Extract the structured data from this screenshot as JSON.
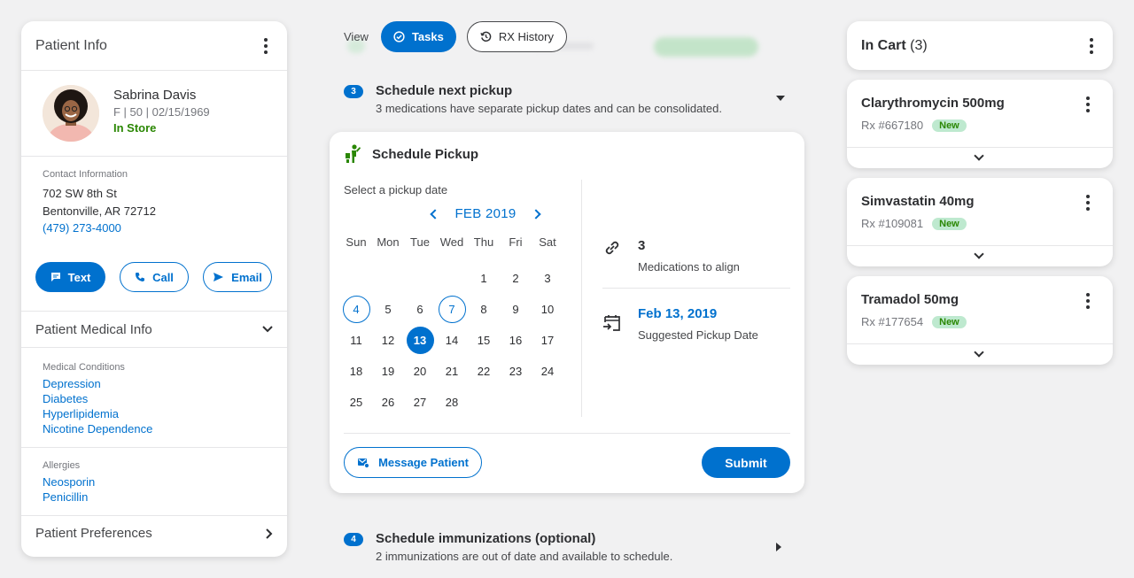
{
  "patient_info": {
    "title": "Patient Info",
    "name": "Sabrina Davis",
    "meta": "F | 50 | 02/15/1969",
    "status": "In Store",
    "contact_label": "Contact Information",
    "address_line1": "702 SW 8th St",
    "address_line2": "Bentonville, AR 72712",
    "phone": "(479) 273-4000",
    "buttons": {
      "text": "Text",
      "call": "Call",
      "email": "Email"
    },
    "medical_info_title": "Patient Medical Info",
    "conditions_label": "Medical Conditions",
    "conditions": [
      "Depression",
      "Diabetes",
      "Hyperlipidemia",
      "Nicotine Dependence"
    ],
    "allergies_label": "Allergies",
    "allergies": [
      "Neosporin",
      "Penicillin"
    ],
    "preferences_title": "Patient Preferences"
  },
  "view": {
    "label": "View",
    "tabs": [
      "Tasks",
      "RX History"
    ]
  },
  "tasks": {
    "pickup_task": {
      "number": "3",
      "title": "Schedule next pickup",
      "subtitle": "3 medications have separate pickup dates and can be consolidated."
    },
    "immunization_task": {
      "number": "4",
      "title": "Schedule immunizations (optional)",
      "subtitle": "2 immunizations are out of date and available to schedule."
    }
  },
  "schedule_pickup": {
    "title": "Schedule Pickup",
    "select_label": "Select a pickup date",
    "month": "FEB 2019",
    "weekdays": [
      "Sun",
      "Mon",
      "Tue",
      "Wed",
      "Thu",
      "Fri",
      "Sat"
    ],
    "weeks": [
      [
        "",
        "",
        "",
        "",
        "1",
        "2",
        "3"
      ],
      [
        "4",
        "5",
        "6",
        "7",
        "8",
        "9",
        "10"
      ],
      [
        "11",
        "12",
        "13",
        "14",
        "15",
        "16",
        "17"
      ],
      [
        "18",
        "19",
        "20",
        "21",
        "22",
        "23",
        "24"
      ],
      [
        "25",
        "26",
        "27",
        "28",
        "",
        "",
        ""
      ]
    ],
    "ringed_days": [
      "4",
      "7"
    ],
    "selected_day": "13",
    "meds_to_align_count": "3",
    "meds_to_align_label": "Medications to align",
    "suggested_date": "Feb 13, 2019",
    "suggested_label": "Suggested Pickup Date",
    "message_button": "Message Patient",
    "submit_button": "Submit"
  },
  "cart": {
    "title": "In Cart",
    "count": "(3)",
    "items": [
      {
        "name": "Clarythromycin 500mg",
        "rx": "Rx #667180",
        "badge": "New"
      },
      {
        "name": "Simvastatin 40mg",
        "rx": "Rx #109081",
        "badge": "New"
      },
      {
        "name": "Tramadol 50mg",
        "rx": "Rx #177654",
        "badge": "New"
      }
    ]
  },
  "colors": {
    "accent": "#0071ce",
    "success": "#2a8703",
    "badge_bg": "#bee9cf",
    "background": "#f1f1f2"
  }
}
